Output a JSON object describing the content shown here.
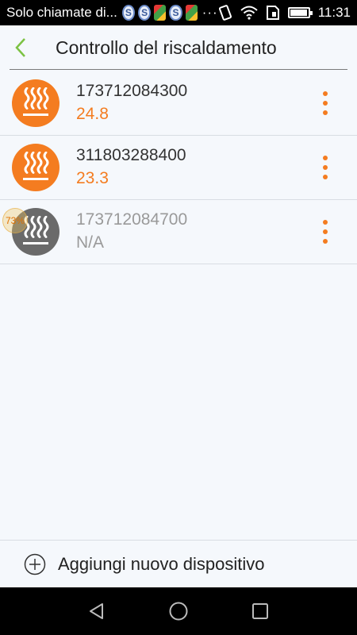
{
  "status_bar": {
    "carrier": "Solo chiamate di...",
    "overflow": "···",
    "time": "11:31",
    "battery_level": 0.95,
    "notification_icons": [
      "s-icon",
      "s-icon",
      "gallery-icon",
      "s-icon",
      "gallery-icon"
    ]
  },
  "header": {
    "title": "Controllo del riscaldamento",
    "back_icon": "chevron-left-icon"
  },
  "devices": [
    {
      "id": "173712084300",
      "value": "24.8",
      "state": "active"
    },
    {
      "id": "311803288400",
      "value": "23.3",
      "state": "active"
    },
    {
      "id": "173712084700",
      "value": "N/A",
      "state": "offline",
      "badge": "73%"
    }
  ],
  "colors": {
    "accent": "#f47c20",
    "back_green": "#7cc243",
    "offline_gray": "#6a6a6a"
  },
  "footer": {
    "add_label": "Aggiungi nuovo dispositivo",
    "add_icon": "plus-circle-icon"
  },
  "nav": {
    "icons": [
      "back-triangle-icon",
      "home-circle-icon",
      "recents-square-icon"
    ]
  }
}
